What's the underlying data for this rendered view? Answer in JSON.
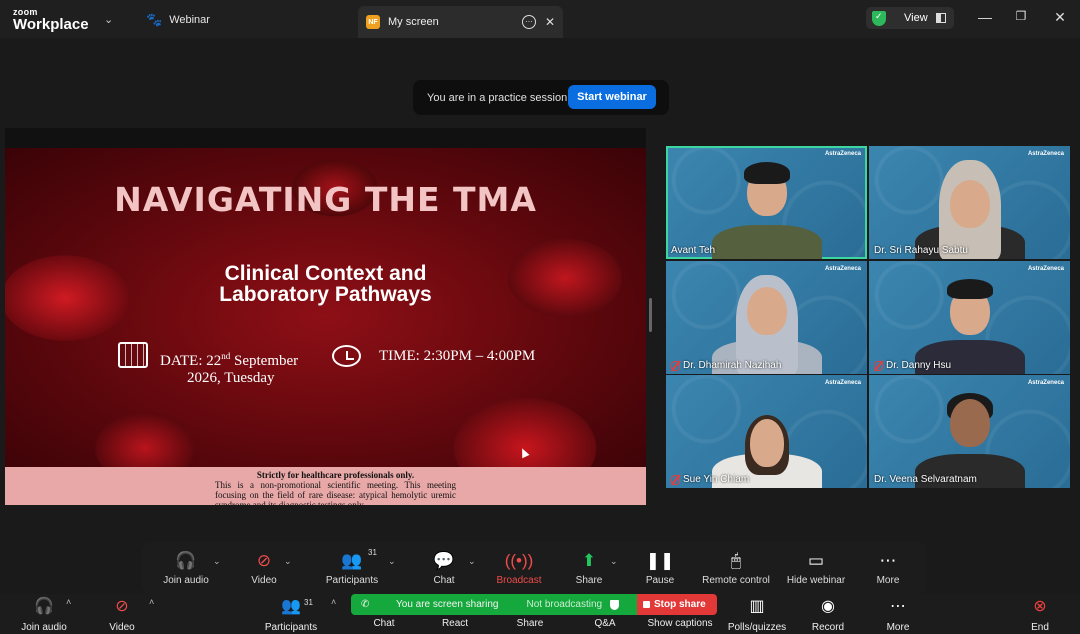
{
  "titlebar": {
    "brand_line1": "zoom",
    "brand_line2": "Workplace",
    "tab_webinar": "Webinar",
    "tab_screen_badge": "NF",
    "tab_screen": "My screen",
    "view_label": "View"
  },
  "banner": {
    "text": "You are in a practice session",
    "start_button": "Start webinar"
  },
  "slide": {
    "title": "NAVIGATING THE TMA",
    "subtitle_line1": "Clinical Context and",
    "subtitle_line2": "Laboratory Pathways",
    "date_prefix": "DATE: 22",
    "date_sup": "nd",
    "date_suffix": " September",
    "date_line2": "2026, Tuesday",
    "time": "TIME: 2:30PM – 4:00PM",
    "footer_bold": "Strictly for healthcare professionals only.",
    "footer_text": "This is a non-promotional scientific meeting. This meeting focusing on the field of rare disease: atypical hemolytic uremic syndrome and its diagnostic testings only."
  },
  "gallery": {
    "brand": "AstraZeneca",
    "participants": [
      {
        "name": "Avant Teh",
        "muted": false,
        "active": true
      },
      {
        "name": "Dr. Sri Rahayu Sabtu",
        "muted": false,
        "active": false
      },
      {
        "name": "Dr. Dhamirah Nazihah",
        "muted": true,
        "active": false
      },
      {
        "name": "Dr. Danny Hsu",
        "muted": true,
        "active": false
      },
      {
        "name": "Sue Yin Chiam",
        "muted": true,
        "active": false
      },
      {
        "name": "Dr. Veena Selvaratnam",
        "muted": false,
        "active": false
      }
    ]
  },
  "floating_toolbar": {
    "join_audio": "Join audio",
    "video": "Video",
    "participants": "Participants",
    "participants_count": "31",
    "chat": "Chat",
    "broadcast": "Broadcast",
    "share": "Share",
    "pause": "Pause",
    "remote_control": "Remote control",
    "hide_webinar": "Hide webinar",
    "more": "More"
  },
  "bottom_toolbar": {
    "join_audio": "Join audio",
    "video": "Video",
    "participants": "Participants",
    "participants_count": "31",
    "chat": "Chat",
    "react": "React",
    "share": "Share",
    "qa": "Q&A",
    "show_captions": "Show captions",
    "polls": "Polls/quizzes",
    "record": "Record",
    "more": "More",
    "end": "End",
    "sharing_status": "You are screen sharing",
    "broadcast_status": "Not broadcasting",
    "stop_share": "Stop share"
  },
  "colors": {
    "accent_blue": "#0b6ee0",
    "share_green": "#15a83c",
    "stop_red": "#e23838",
    "active_speaker": "#3cd6a0"
  }
}
